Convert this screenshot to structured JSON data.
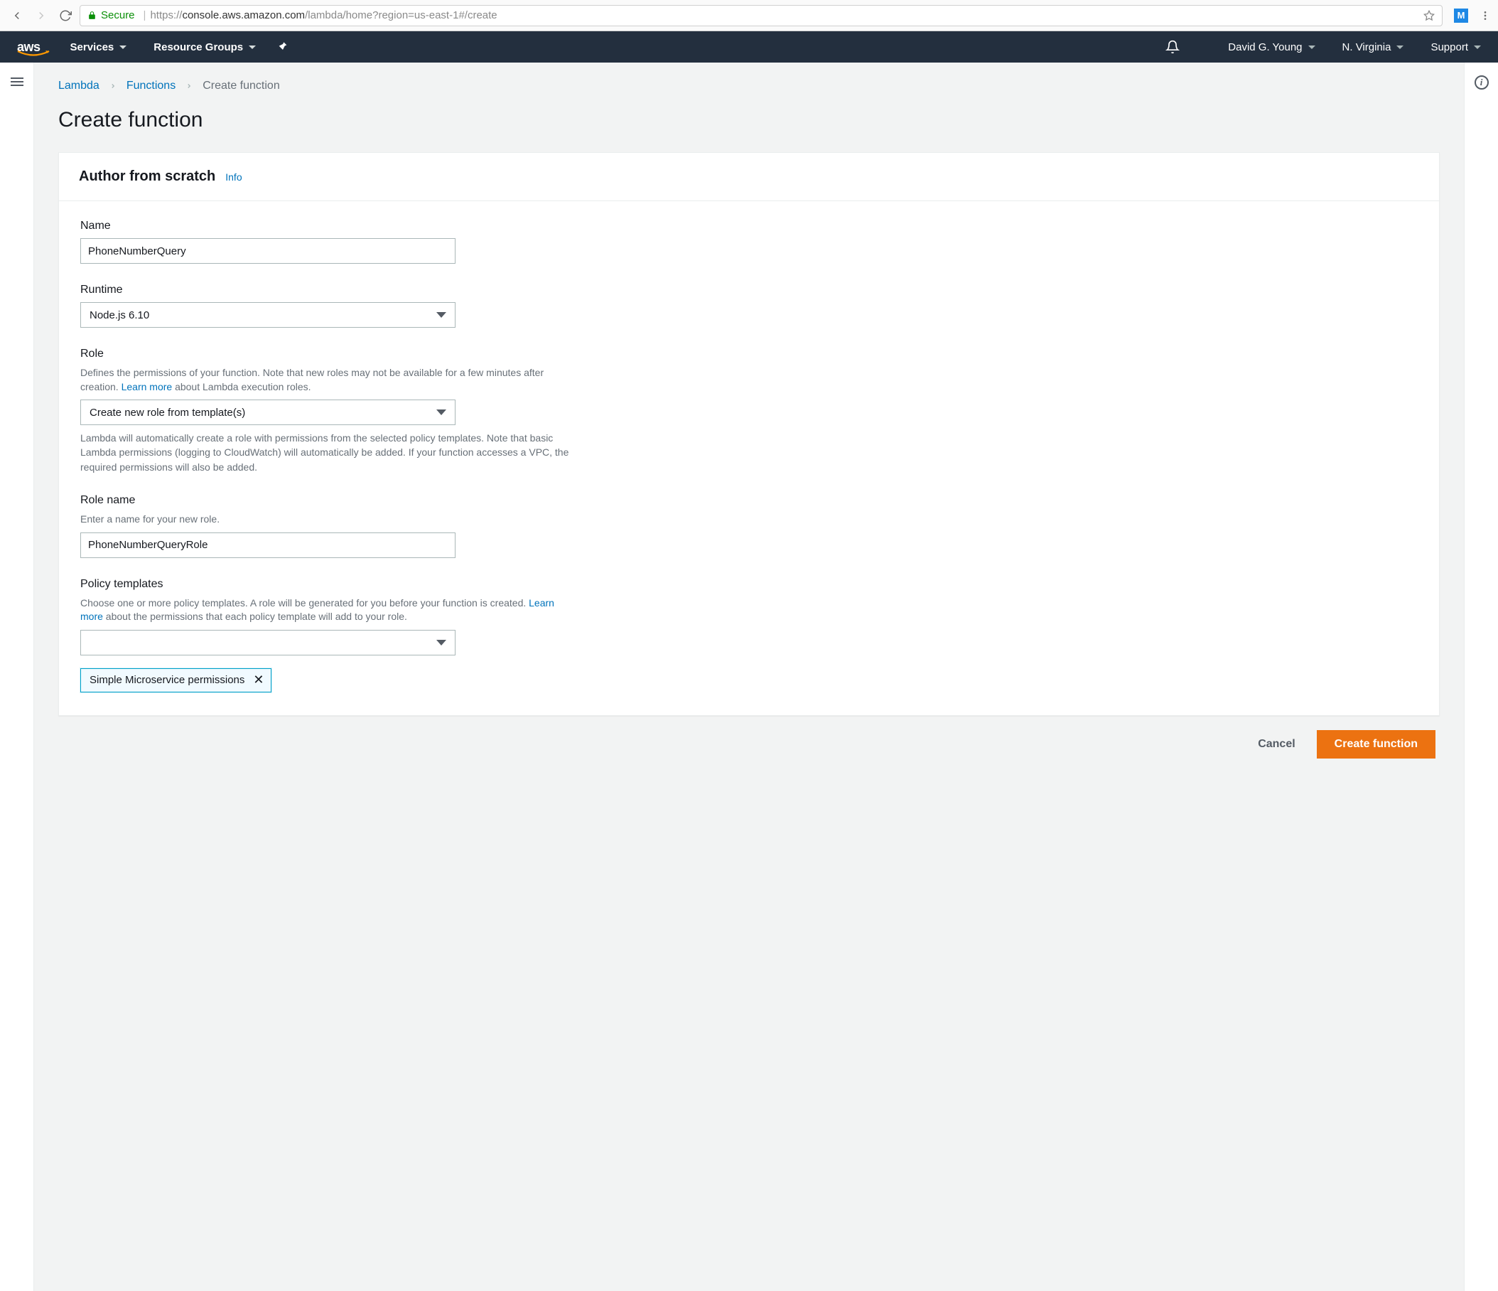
{
  "browser": {
    "secure_label": "Secure",
    "url_proto": "https://",
    "url_host": "console.aws.amazon.com",
    "url_path": "/lambda/home?region=us-east-1#/create",
    "profile_initial": "M"
  },
  "nav": {
    "logo": "aws",
    "services": "Services",
    "resource_groups": "Resource Groups",
    "user": "David G. Young",
    "region": "N. Virginia",
    "support": "Support"
  },
  "breadcrumb": {
    "lambda": "Lambda",
    "functions": "Functions",
    "current": "Create function"
  },
  "page": {
    "title": "Create function"
  },
  "panel": {
    "title": "Author from scratch",
    "info": "Info"
  },
  "fields": {
    "name": {
      "label": "Name",
      "value": "PhoneNumberQuery"
    },
    "runtime": {
      "label": "Runtime",
      "value": "Node.js 6.10"
    },
    "role": {
      "label": "Role",
      "desc_pre": "Defines the permissions of your function. Note that new roles may not be available for a few minutes after creation. ",
      "learn_more": "Learn more",
      "desc_post": " about Lambda execution roles.",
      "value": "Create new role from template(s)",
      "helper": "Lambda will automatically create a role with permissions from the selected policy templates. Note that basic Lambda permissions (logging to CloudWatch) will automatically be added. If your function accesses a VPC, the required permissions will also be added."
    },
    "role_name": {
      "label": "Role name",
      "desc": "Enter a name for your new role.",
      "value": "PhoneNumberQueryRole"
    },
    "policy_templates": {
      "label": "Policy templates",
      "desc_pre": "Choose one or more policy templates. A role will be generated for you before your function is created. ",
      "learn_more": "Learn more",
      "desc_post": " about the permissions that each policy template will add to your role.",
      "value": "",
      "tag": "Simple Microservice permissions"
    }
  },
  "actions": {
    "cancel": "Cancel",
    "create": "Create function"
  }
}
